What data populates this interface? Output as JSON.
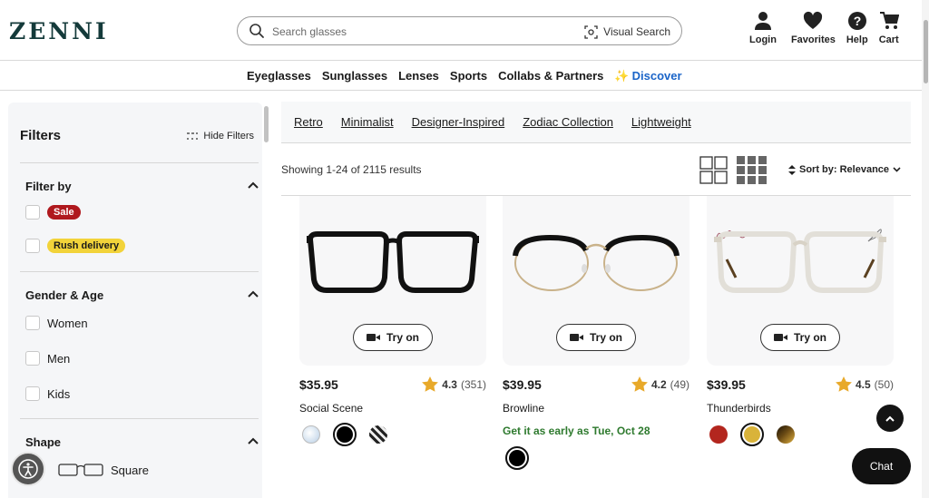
{
  "header": {
    "logo_text": "ZENNI",
    "search_placeholder": "Search glasses",
    "visual_search_label": "Visual Search",
    "icons": [
      {
        "label": "Login",
        "icon": "user-icon"
      },
      {
        "label": "Favorites",
        "icon": "heart-icon"
      },
      {
        "label": "Help",
        "icon": "help-icon"
      },
      {
        "label": "Cart",
        "icon": "cart-icon"
      }
    ]
  },
  "nav": {
    "items": [
      "Eyeglasses",
      "Sunglasses",
      "Lenses",
      "Sports",
      "Collabs & Partners"
    ],
    "discover_label": "Discover"
  },
  "sidebar": {
    "title": "Filters",
    "hide_filters_label": "Hide Filters",
    "filter_by": {
      "title": "Filter by",
      "sale_label": "Sale",
      "rush_label": "Rush delivery"
    },
    "gender_age": {
      "title": "Gender & Age",
      "options": [
        "Women",
        "Men",
        "Kids"
      ]
    },
    "shape": {
      "title": "Shape",
      "options": [
        "Square"
      ]
    }
  },
  "tags": [
    "Retro",
    "Minimalist",
    "Designer-Inspired",
    "Zodiac Collection",
    "Lightweight"
  ],
  "results": {
    "showing_text": "Showing 1-24 of 2115 results",
    "sort_label": "Sort by: Relevance"
  },
  "products": [
    {
      "name": "Social Scene",
      "price": "$35.95",
      "rating": "4.3",
      "reviews": "(351)",
      "try_on": "Try on"
    },
    {
      "name": "Browline",
      "price": "$39.95",
      "rating": "4.2",
      "reviews": "(49)",
      "try_on": "Try on",
      "delivery_note": "Get it as early as Tue, Oct 28"
    },
    {
      "name": "Thunderbirds",
      "price": "$39.95",
      "rating": "4.5",
      "reviews": "(50)",
      "try_on": "Try on"
    }
  ],
  "chat_label": "Chat",
  "colors": {
    "sale": "#b0191e",
    "rush": "#f2d33a",
    "discover": "#1a64c8",
    "star": "#e8a92a",
    "early": "#2e7a2e"
  }
}
